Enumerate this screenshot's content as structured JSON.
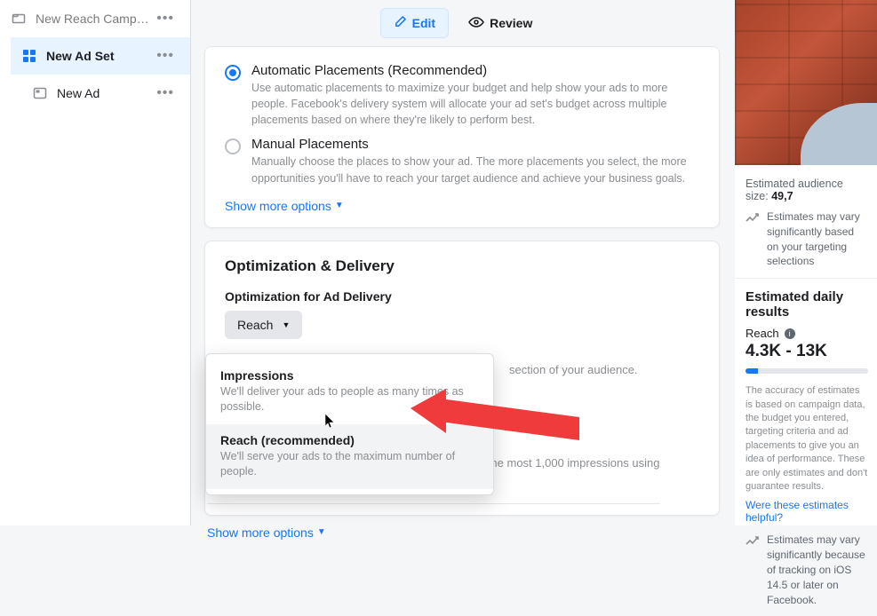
{
  "sidebar": {
    "items": [
      {
        "label": "New Reach Campai…"
      },
      {
        "label": "New Ad Set"
      },
      {
        "label": "New Ad"
      }
    ]
  },
  "top": {
    "edit_label": "Edit",
    "review_label": "Review"
  },
  "placements": {
    "auto_title": "Automatic Placements (Recommended)",
    "auto_desc": "Use automatic placements to maximize your budget and help show your ads to more people. Facebook's delivery system will allocate your ad set's budget across multiple placements based on where they're likely to perform best.",
    "manual_title": "Manual Placements",
    "manual_desc": "Manually choose the places to show your ad. The more placements you select, the more opportunities you'll have to reach your target audience and achieve your business goals.",
    "show_more": "Show more options"
  },
  "optdel": {
    "section_title": "Optimization & Delivery",
    "field_label": "Optimization for Ad Delivery",
    "selected": "Reach",
    "hint_right": "section of your audience.",
    "options": [
      {
        "title": "Impressions",
        "desc": "We'll deliver your ads to people as many times as possible."
      },
      {
        "title": "Reach (recommended)",
        "desc": "We'll serve your ads to the maximum number of people."
      }
    ],
    "cost_text": "Facebook will aim to spend your entire budget and get the most 1,000 impressions using the lowest cost bid strategy.",
    "show_more": "Show more options"
  },
  "right": {
    "audience_size_label": "Estimated audience size:",
    "audience_size_value": "49,7",
    "vary_note": "Estimates may vary significantly based on your targeting selections",
    "daily_title": "Estimated daily results",
    "reach_label": "Reach",
    "reach_range": "4.3K - 13K",
    "accuracy_text": "The accuracy of estimates is based on campaign data, the budget you entered, targeting criteria and ad placements to give you an idea of performance. These are only estimates and don't guarantee results.",
    "helpful_link": "Were these estimates helpful?",
    "ios_note": "Estimates may vary significantly because of tracking on iOS 14.5 or later on Facebook."
  }
}
